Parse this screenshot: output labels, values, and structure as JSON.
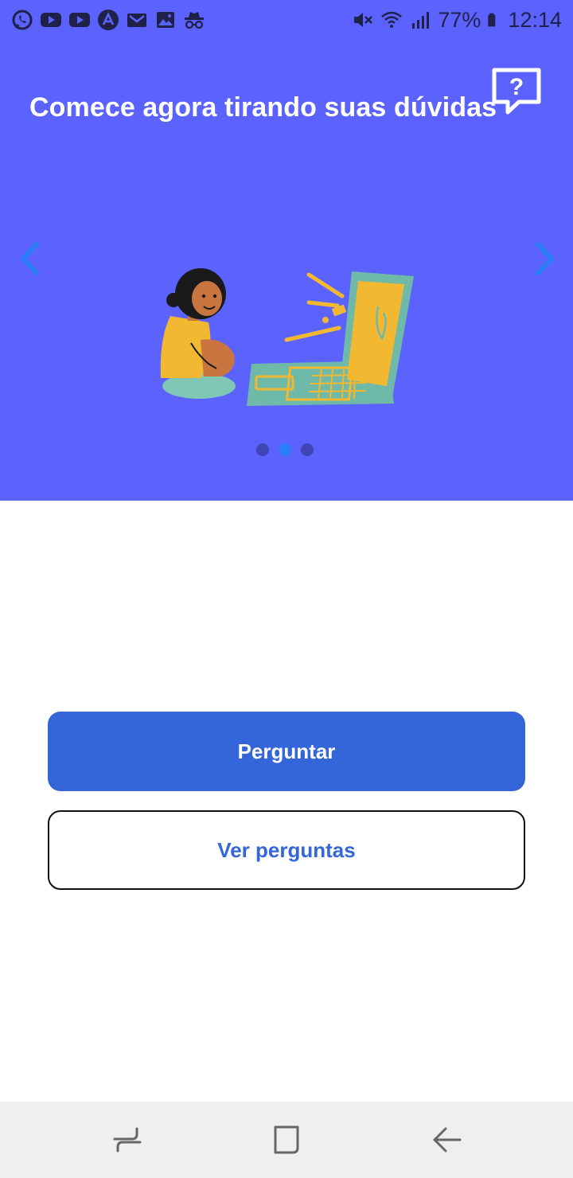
{
  "status_bar": {
    "battery_percent": "77%",
    "time": "12:14",
    "left_icons": [
      "whatsapp-icon",
      "youtube-icon",
      "youtube-icon",
      "arc-app-icon",
      "gmail-icon",
      "gallery-icon",
      "incognito-icon"
    ],
    "right_icons": [
      "mute-icon",
      "wifi-icon",
      "signal-icon",
      "battery-icon"
    ]
  },
  "hero": {
    "title": "Comece agora tirando suas dúvidas",
    "carousel": {
      "slide_count": 3,
      "active_index": 1
    },
    "colors": {
      "background": "#5b62fd",
      "arrows": "#2a7ef7"
    }
  },
  "actions": {
    "primary_label": "Perguntar",
    "secondary_label": "Ver perguntas",
    "accent_color": "#3465d9"
  },
  "nav_bar": {
    "icons": [
      "recent-apps-icon",
      "home-icon",
      "back-icon"
    ]
  }
}
